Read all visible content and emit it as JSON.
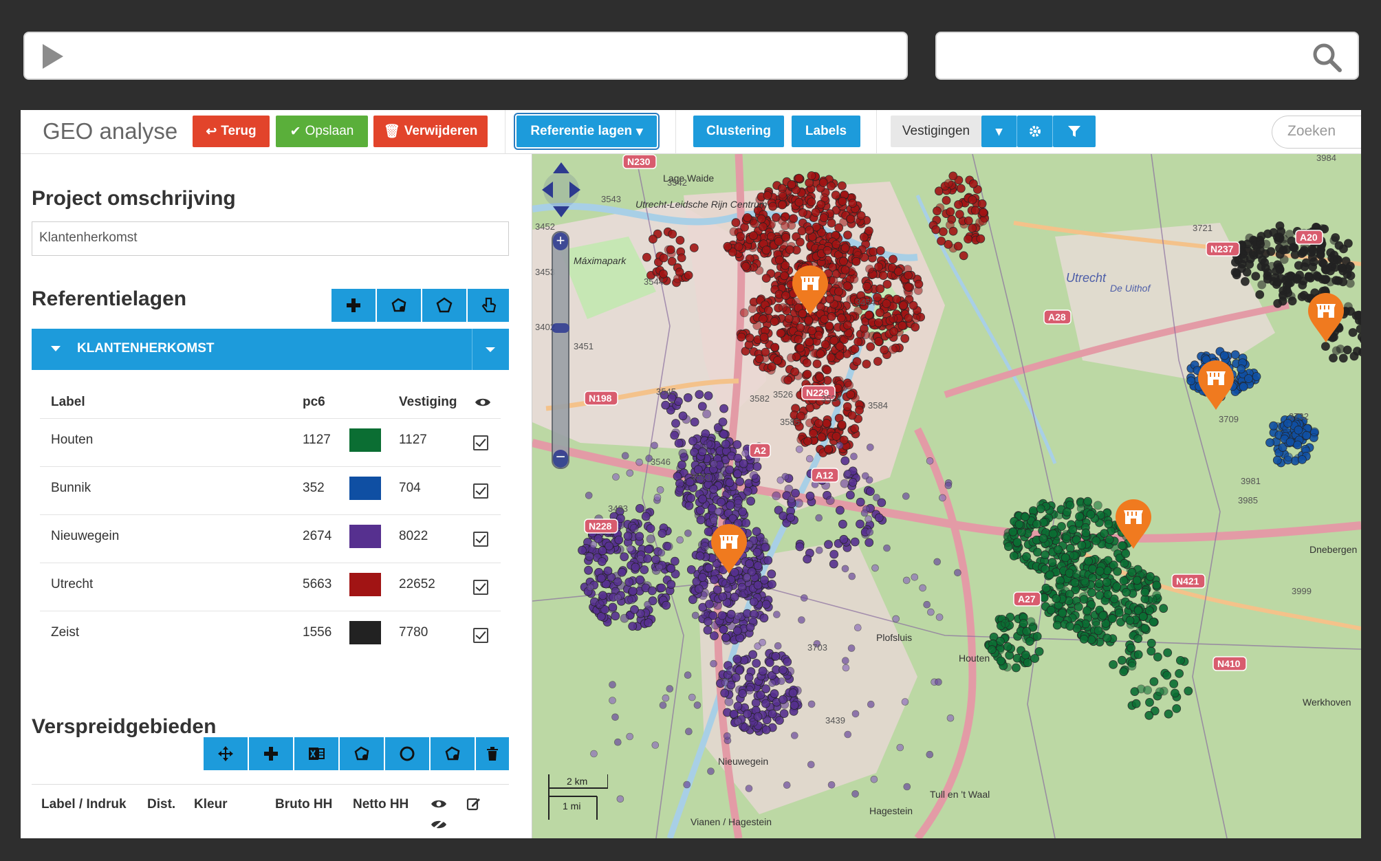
{
  "browser": {
    "play_icon": "play-icon",
    "search_icon": "search-icon"
  },
  "toolbar": {
    "title": "GEO analyse",
    "back_label": "Terug",
    "save_label": "Opslaan",
    "delete_label": "Verwijderen",
    "reference_layers_label": "Referentie lagen",
    "clustering_label": "Clustering",
    "labels_label": "Labels",
    "vestigingen_label": "Vestigingen",
    "search_placeholder": "Zoeken"
  },
  "project": {
    "heading": "Project omschrijving",
    "value": "Klantenherkomst"
  },
  "referentielagen": {
    "heading": "Referentielagen",
    "layer_name": "KLANTENHERKOMST",
    "columns": {
      "label": "Label",
      "pc6": "pc6",
      "vestiging": "Vestiging"
    },
    "rows": [
      {
        "label": "Houten",
        "pc6": "1127",
        "color": "#0b6e33",
        "vestiging": "1127",
        "visible": true
      },
      {
        "label": "Bunnik",
        "pc6": "352",
        "color": "#0f4fa3",
        "vestiging": "704",
        "visible": true
      },
      {
        "label": "Nieuwegein",
        "pc6": "2674",
        "color": "#56308f",
        "vestiging": "8022",
        "visible": true
      },
      {
        "label": "Utrecht",
        "pc6": "5663",
        "color": "#a11414",
        "vestiging": "22652",
        "visible": true
      },
      {
        "label": "Zeist",
        "pc6": "1556",
        "color": "#222222",
        "vestiging": "7780",
        "visible": true
      }
    ]
  },
  "verspreidgebieden": {
    "heading": "Verspreidgebieden",
    "columns": {
      "label": "Label / Indruk",
      "dist": "Dist.",
      "kleur": "Kleur",
      "bruto": "Bruto HH",
      "netto": "Netto HH"
    }
  },
  "map": {
    "place_labels": [
      "Lage Waide",
      "Utrecht-Leidsche Rijn Centrum",
      "Máximapark",
      "Utrecht",
      "De Uithof",
      "Werkhoven",
      "Tull en 't Waal",
      "Houten",
      "Nieuwegein",
      "Vianen / Hagestein",
      "Hagestein",
      "Plofsluis",
      "Dnebergen"
    ],
    "road_labels": [
      "A2",
      "A12",
      "A27",
      "A28",
      "N198",
      "N228",
      "N237",
      "N410",
      "N421",
      "N229",
      "N230",
      "A20"
    ],
    "postcode_labels": [
      "3542",
      "3543",
      "3544",
      "3545",
      "3546",
      "3526",
      "3524",
      "3584",
      "3583",
      "3582",
      "3585",
      "3454",
      "3451",
      "3452",
      "3453",
      "3402",
      "3433",
      "3439",
      "3703",
      "3709",
      "3732",
      "3721",
      "3984",
      "3981",
      "3985",
      "3999"
    ],
    "scale": {
      "km": "2 km",
      "mi": "1 mi"
    },
    "marker_icon": "shop-marker-icon"
  }
}
